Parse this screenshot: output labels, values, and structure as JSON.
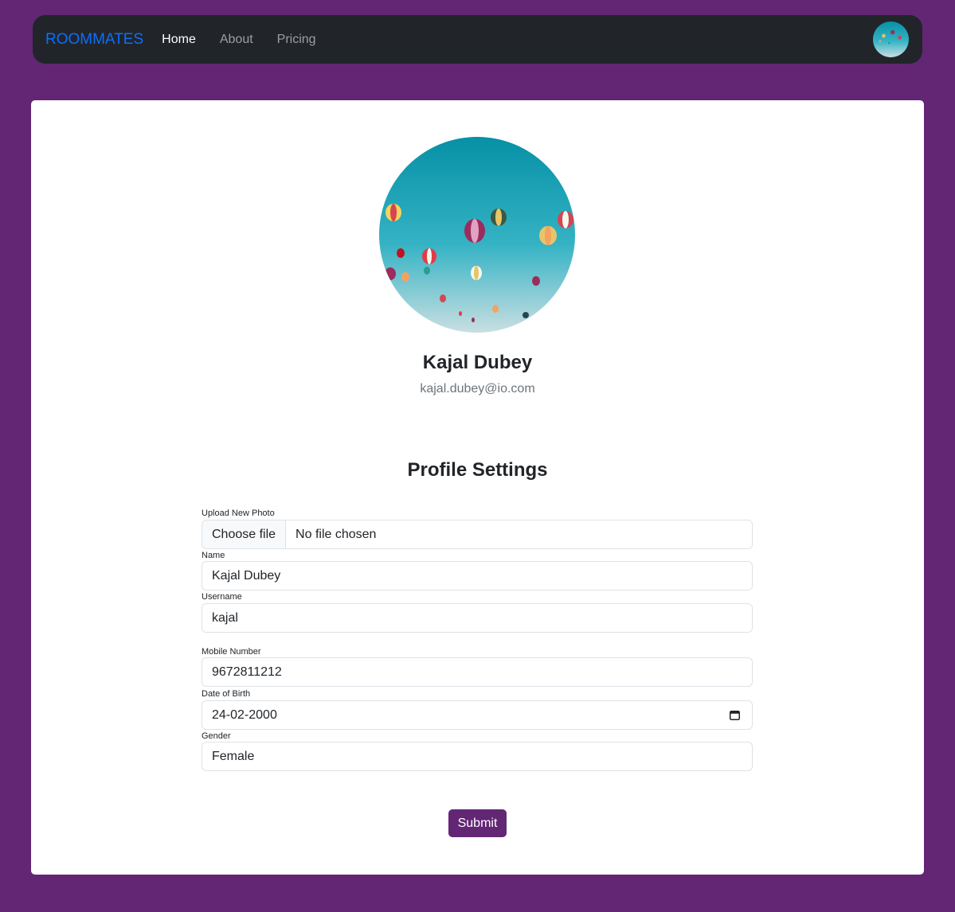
{
  "navbar": {
    "brand": "ROOMMATES",
    "links": [
      {
        "label": "Home",
        "active": true
      },
      {
        "label": "About",
        "active": false
      },
      {
        "label": "Pricing",
        "active": false
      }
    ],
    "avatar_icon": "user-avatar-balloons"
  },
  "profile": {
    "name": "Kajal Dubey",
    "email": "kajal.dubey@io.com",
    "photo_icon": "hot-air-balloons-photo"
  },
  "settings": {
    "title": "Profile Settings",
    "upload": {
      "label": "Upload New Photo",
      "button": "Choose file",
      "status": "No file chosen"
    },
    "name": {
      "label": "Name",
      "value": "Kajal Dubey"
    },
    "username": {
      "label": "Username",
      "value": "kajal"
    },
    "mobile": {
      "label": "Mobile Number",
      "value": "9672811212"
    },
    "dob": {
      "label": "Date of Birth",
      "value": "24-02-2000",
      "icon": "calendar-icon"
    },
    "gender": {
      "label": "Gender",
      "value": "Female"
    },
    "submit": "Submit"
  },
  "colors": {
    "page_bg": "#622675",
    "navbar_bg": "#212529",
    "brand": "#0d6efd",
    "submit_bg": "#622675"
  }
}
